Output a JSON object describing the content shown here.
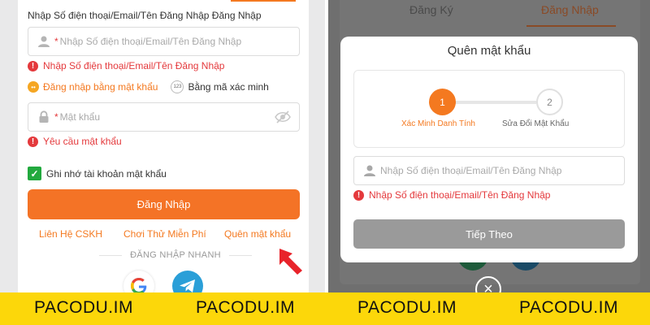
{
  "login": {
    "field_label": "Nhập Số điện thoại/Email/Tên Đăng Nhập Đăng Nhập",
    "username_placeholder": "Nhập Số điện thoại/Email/Tên Đăng Nhập",
    "username_error": "Nhập Số điện thoại/Email/Tên Đăng Nhập",
    "mode_password": "Đăng nhập bằng mật khẩu",
    "mode_code_icon": "123",
    "mode_code": "Bằng mã xác minh",
    "password_placeholder": "Mật khẩu",
    "password_error": "Yêu cầu mật khẩu",
    "remember": "Ghi nhớ tài khoản mật khẩu",
    "login_button": "Đăng Nhập",
    "link_support": "Liên Hệ CSKH",
    "link_trial": "Chơi Thử Miễn Phí",
    "link_forgot": "Quên mật khẩu",
    "quick_login": "ĐĂNG NHẬP NHANH"
  },
  "background_tabs": {
    "register": "Đăng Ký",
    "login": "Đăng Nhập"
  },
  "modal": {
    "title": "Quên mật khẩu",
    "step1_number": "1",
    "step1_label": "Xác Minh Danh Tính",
    "step2_number": "2",
    "step2_label": "Sửa Đổi Mật Khẩu",
    "input_placeholder": "Nhập Số điện thoại/Email/Tên Đăng Nhập",
    "input_error": "Nhập Số điện thoại/Email/Tên Đăng Nhập",
    "next_button": "Tiếp Theo",
    "close_symbol": "×"
  },
  "watermark": {
    "text1": "PACODU.IM",
    "text2": "PACODU.IM",
    "text3": "PACODU.IM",
    "text4": "PACODU.IM"
  },
  "colors": {
    "accent": "#f47326",
    "error": "#e4393c",
    "checkbox": "#22a93e",
    "band": "#fcd70a",
    "overlay": "#6f6f6f"
  },
  "icons": [
    "user-icon",
    "lock-icon",
    "eye-off-icon",
    "error-icon",
    "checkmark-icon",
    "google-icon",
    "telegram-icon",
    "red-arrow-icon",
    "close-icon"
  ]
}
